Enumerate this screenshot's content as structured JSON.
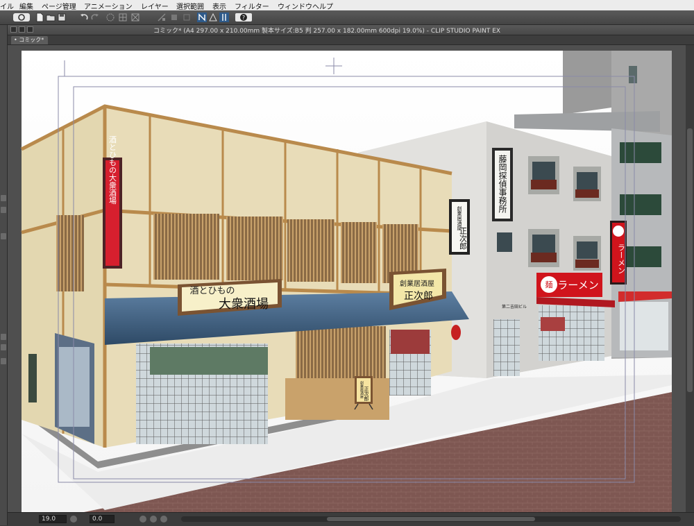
{
  "menu": {
    "items": [
      "イル",
      "編集",
      "ページ管理",
      "アニメーション",
      "レイヤー",
      "選択範囲",
      "表示",
      "フィルター",
      "ウィンドウ",
      "ヘルプ"
    ]
  },
  "toolbar": {
    "icons": [
      "clip-logo-icon",
      "new-file-icon",
      "open-file-icon",
      "save-icon",
      "undo-icon",
      "redo-icon",
      "transform-icon",
      "snap-icon",
      "grid-icon",
      "ruler-snap-icon",
      "perspective-icon",
      "help-icon"
    ]
  },
  "window": {
    "title": "コミック* (A4 297.00 x 210.00mm 製本サイズ:B5 判 257.00 x 182.00mm 600dpi 19.0%)  - CLIP STUDIO PAINT EX",
    "tab_label": "コミック*"
  },
  "signs": {
    "izakaya_top": "酒とひもの",
    "izakaya_main": "大衆酒場",
    "izakaya_vertical": "酒とひもの大衆酒場",
    "masajiro_small": "創業居酒屋",
    "masajiro_name": "正次郎",
    "masajiro_vertical_small": "創業居酒屋",
    "masajiro_vertical_name": "正次郎",
    "standboard_small": "創業居酒屋",
    "standboard_name": "正次郎",
    "detective": "藤岡探偵事務所",
    "ramen": "ラーメン",
    "ramen_mark": "麺",
    "building_plate": "第二吉田ビル"
  },
  "status": {
    "zoom": "19.0",
    "angle": "0.0"
  },
  "colors": {
    "awning_blue": "#3f5f7e",
    "ramen_red": "#d0141c",
    "road_brick": "#7e5752"
  }
}
